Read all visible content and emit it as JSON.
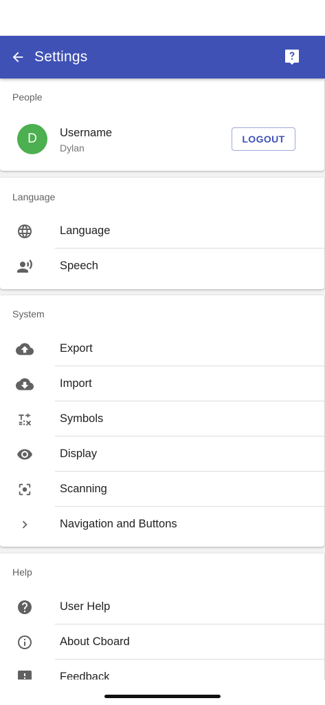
{
  "app_bar": {
    "title": "Settings",
    "back_icon": "arrow-back-icon",
    "help_icon": "help-icon",
    "color": "#3f51b5"
  },
  "people": {
    "section_title": "People",
    "avatar_initial": "D",
    "avatar_color": "#4caf50",
    "username_label": "Username",
    "username_value": "Dylan",
    "logout_label": "LOGOUT"
  },
  "language": {
    "section_title": "Language",
    "items": [
      {
        "label": "Language",
        "icon": "globe-icon"
      },
      {
        "label": "Speech",
        "icon": "record-voice-icon"
      }
    ]
  },
  "system": {
    "section_title": "System",
    "items": [
      {
        "label": "Export",
        "icon": "cloud-upload-icon"
      },
      {
        "label": "Import",
        "icon": "cloud-download-icon"
      },
      {
        "label": "Symbols",
        "icon": "symbols-icon"
      },
      {
        "label": "Display",
        "icon": "eye-icon"
      },
      {
        "label": "Scanning",
        "icon": "scan-icon"
      },
      {
        "label": "Navigation and Buttons",
        "icon": "chevron-right-icon"
      }
    ]
  },
  "help": {
    "section_title": "Help",
    "items": [
      {
        "label": "User Help",
        "icon": "help-circle-icon"
      },
      {
        "label": "About Cboard",
        "icon": "info-icon"
      },
      {
        "label": "Feedback",
        "icon": "feedback-icon"
      }
    ]
  }
}
